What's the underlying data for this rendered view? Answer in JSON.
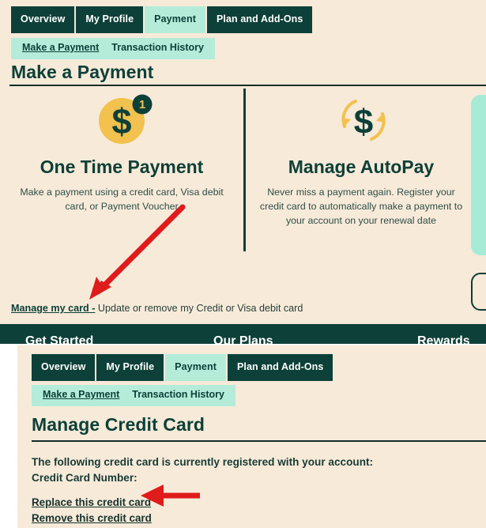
{
  "colors": {
    "page_bg": "#f7ead9",
    "dark_teal": "#0d4038",
    "mint": "#b4ecd9",
    "gold": "#f2c14e",
    "annotation_red": "#e01b1b"
  },
  "top_screenshot": {
    "tabs": [
      {
        "label": "Overview",
        "active": false
      },
      {
        "label": "My Profile",
        "active": false
      },
      {
        "label": "Payment",
        "active": true
      },
      {
        "label": "Plan and Add-Ons",
        "active": false
      }
    ],
    "subtabs": [
      {
        "label": "Make a Payment",
        "selected": true
      },
      {
        "label": "Transaction History",
        "selected": false
      }
    ],
    "page_title": "Make a Payment",
    "cards": [
      {
        "icon": "dollar-coin-one-icon",
        "badge": "1",
        "title": "One Time Payment",
        "description": "Make a payment using a credit card, Visa debit card, or Payment Voucher"
      },
      {
        "icon": "autopay-recurring-dollar-icon",
        "title": "Manage AutoPay",
        "description": "Never miss a payment again. Register your credit card to automatically make a payment to your account on your renewal date"
      }
    ],
    "manage_link": {
      "link_text": "Manage my card -",
      "rest_text": " Update or remove my Credit or Visa debit card"
    },
    "footer_columns": [
      "Get Started",
      "Our Plans",
      "Rewards"
    ]
  },
  "bottom_screenshot": {
    "tabs": [
      {
        "label": "Overview",
        "active": false
      },
      {
        "label": "My Profile",
        "active": false
      },
      {
        "label": "Payment",
        "active": true
      },
      {
        "label": "Plan and Add-Ons",
        "active": false
      }
    ],
    "subtabs": [
      {
        "label": "Make a Payment",
        "selected": true
      },
      {
        "label": "Transaction History",
        "selected": false
      }
    ],
    "page_title": "Manage Credit Card",
    "status_line_1": "The following credit card is currently registered with your account:",
    "status_line_2": "Credit Card Number:",
    "links": [
      {
        "label": "Replace this credit card"
      },
      {
        "label": "Remove this credit card"
      }
    ]
  },
  "annotations": [
    {
      "name": "arrow-to-manage-my-card",
      "direction": "down-left"
    },
    {
      "name": "arrow-to-replace-this-credit-card",
      "direction": "left"
    }
  ]
}
